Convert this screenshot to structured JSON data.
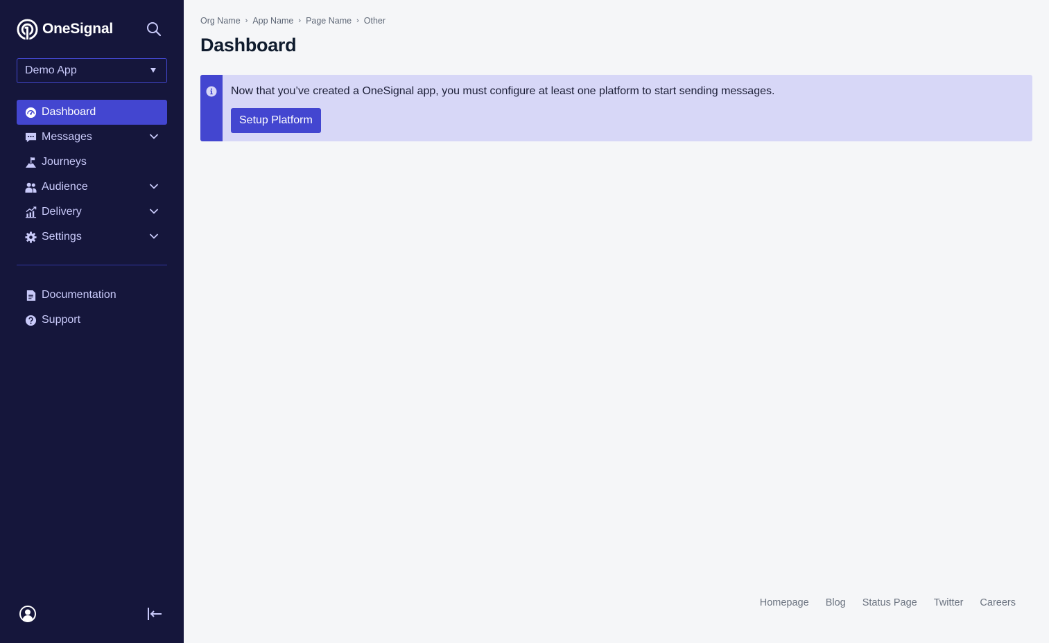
{
  "sidebar": {
    "brand": "OneSignal",
    "app_selector": {
      "value": "Demo App"
    },
    "nav_items": [
      {
        "label": "Dashboard",
        "icon": "dashboard-icon",
        "active": true,
        "expandable": false
      },
      {
        "label": "Messages",
        "icon": "messages-icon",
        "active": false,
        "expandable": true
      },
      {
        "label": "Journeys",
        "icon": "journeys-icon",
        "active": false,
        "expandable": false
      },
      {
        "label": "Audience",
        "icon": "audience-icon",
        "active": false,
        "expandable": true
      },
      {
        "label": "Delivery",
        "icon": "delivery-icon",
        "active": false,
        "expandable": true
      },
      {
        "label": "Settings",
        "icon": "settings-icon",
        "active": false,
        "expandable": true
      }
    ],
    "secondary_items": [
      {
        "label": "Documentation",
        "icon": "document-icon"
      },
      {
        "label": "Support",
        "icon": "help-icon"
      }
    ]
  },
  "header": {
    "breadcrumb": [
      "Org Name",
      "App Name",
      "Page Name",
      "Other"
    ],
    "title": "Dashboard"
  },
  "banner": {
    "message": "Now that you’ve created a OneSignal app, you must configure at least one platform to start sending messages.",
    "button_label": "Setup Platform"
  },
  "footer": {
    "links": [
      "Homepage",
      "Blog",
      "Status Page",
      "Twitter",
      "Careers"
    ]
  },
  "colors": {
    "sidebar_bg": "#15163b",
    "accent": "#4346d0",
    "banner_bg": "#d7d7f7",
    "page_bg": "#f5f6f8"
  }
}
